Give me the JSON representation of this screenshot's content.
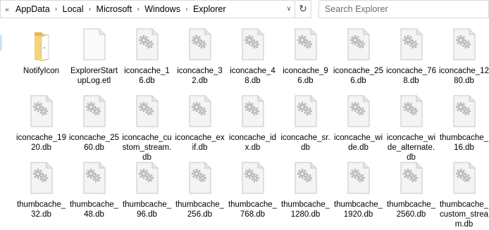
{
  "address": {
    "chevron": "«",
    "crumbs": [
      "AppData",
      "Local",
      "Microsoft",
      "Windows",
      "Explorer"
    ],
    "refresh_icon": "refresh-icon"
  },
  "search": {
    "placeholder": "Search Explorer"
  },
  "files": [
    {
      "name": "NotifyIcon",
      "icon": "folder-icon"
    },
    {
      "name": "ExplorerStartupLog.etl",
      "icon": "blank-file-icon"
    },
    {
      "name": "iconcache_16.db",
      "icon": "gear-file-icon"
    },
    {
      "name": "iconcache_32.db",
      "icon": "gear-file-icon"
    },
    {
      "name": "iconcache_48.db",
      "icon": "gear-file-icon"
    },
    {
      "name": "iconcache_96.db",
      "icon": "gear-file-icon"
    },
    {
      "name": "iconcache_256.db",
      "icon": "gear-file-icon"
    },
    {
      "name": "iconcache_768.db",
      "icon": "gear-file-icon"
    },
    {
      "name": "iconcache_1280.db",
      "icon": "gear-file-icon"
    },
    {
      "name": "iconcache_1920.db",
      "icon": "gear-file-icon"
    },
    {
      "name": "iconcache_2560.db",
      "icon": "gear-file-icon"
    },
    {
      "name": "iconcache_custom_stream.db",
      "icon": "gear-file-icon"
    },
    {
      "name": "iconcache_exif.db",
      "icon": "gear-file-icon"
    },
    {
      "name": "iconcache_idx.db",
      "icon": "gear-file-icon"
    },
    {
      "name": "iconcache_sr.db",
      "icon": "gear-file-icon"
    },
    {
      "name": "iconcache_wide.db",
      "icon": "gear-file-icon"
    },
    {
      "name": "iconcache_wide_alternate.db",
      "icon": "gear-file-icon"
    },
    {
      "name": "thumbcache_16.db",
      "icon": "gear-file-icon"
    },
    {
      "name": "thumbcache_32.db",
      "icon": "gear-file-icon"
    },
    {
      "name": "thumbcache_48.db",
      "icon": "gear-file-icon"
    },
    {
      "name": "thumbcache_96.db",
      "icon": "gear-file-icon"
    },
    {
      "name": "thumbcache_256.db",
      "icon": "gear-file-icon"
    },
    {
      "name": "thumbcache_768.db",
      "icon": "gear-file-icon"
    },
    {
      "name": "thumbcache_1280.db",
      "icon": "gear-file-icon"
    },
    {
      "name": "thumbcache_1920.db",
      "icon": "gear-file-icon"
    },
    {
      "name": "thumbcache_2560.db",
      "icon": "gear-file-icon"
    },
    {
      "name": "thumbcache_custom_stream.db",
      "icon": "gear-file-icon"
    }
  ],
  "colors": {
    "folder": "#f0c85a",
    "selection": "#cce4f7",
    "border": "#d9d9d9"
  }
}
